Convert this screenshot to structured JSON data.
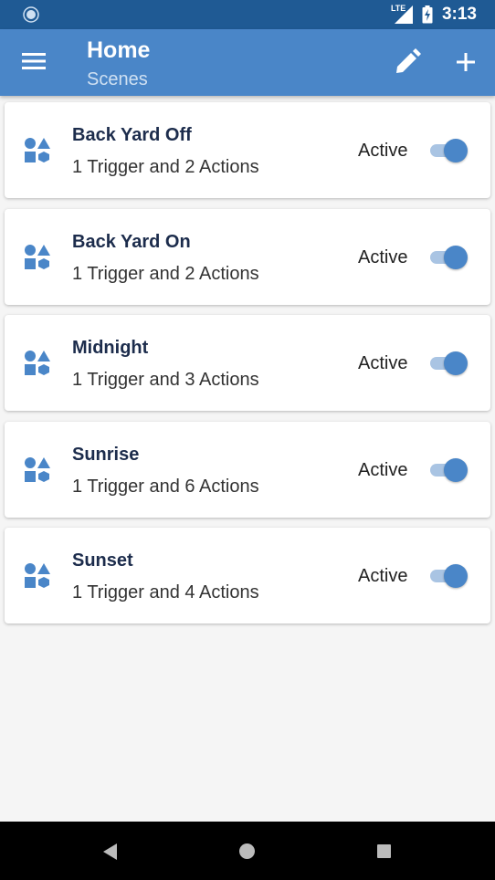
{
  "status_bar": {
    "network": "LTE",
    "time": "3:13"
  },
  "app_bar": {
    "title": "Home",
    "subtitle": "Scenes",
    "menu_icon": "hamburger-menu-icon",
    "edit_icon": "pencil-icon",
    "add_icon": "plus-icon"
  },
  "scenes": [
    {
      "name": "Back Yard Off",
      "description": "1 Trigger and 2 Actions",
      "status": "Active",
      "enabled": true
    },
    {
      "name": "Back Yard On",
      "description": "1 Trigger and 2 Actions",
      "status": "Active",
      "enabled": true
    },
    {
      "name": "Midnight",
      "description": "1 Trigger and 3 Actions",
      "status": "Active",
      "enabled": true
    },
    {
      "name": "Sunrise",
      "description": "1 Trigger and 6 Actions",
      "status": "Active",
      "enabled": true
    },
    {
      "name": "Sunset",
      "description": "1 Trigger and 4 Actions",
      "status": "Active",
      "enabled": true
    }
  ],
  "colors": {
    "status_bar": "#1f5a94",
    "app_bar": "#4a86c8",
    "accent": "#4a86c8",
    "toggle_track": "#a9c4e3",
    "background": "#f5f5f5"
  }
}
